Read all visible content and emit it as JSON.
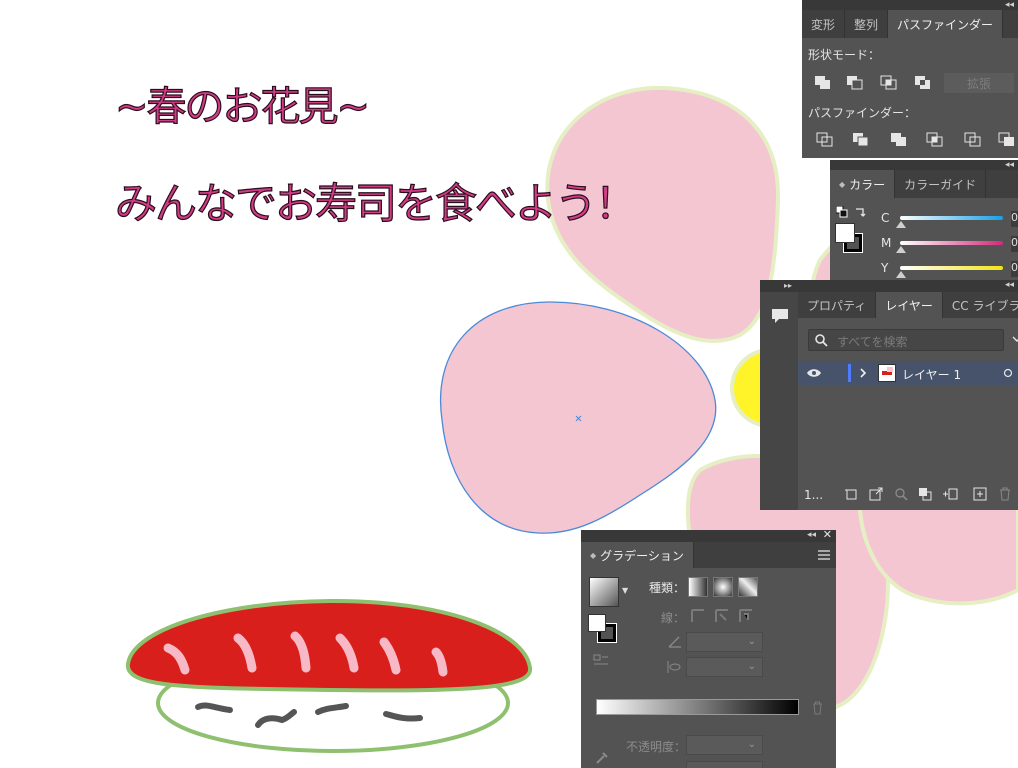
{
  "artwork": {
    "title_line": "~春のお花見~",
    "subtitle_line": "みんなでお寿司を食べよう！",
    "colors": {
      "title_fill": "#d03c86",
      "title_stroke": "#2a0d1c",
      "petal": "#f4c6d2",
      "petal_outline": "#e6efc4",
      "flower_center": "#fff42a",
      "sushi_tuna": "#d91f1c",
      "sushi_outline": "#8ec070",
      "selection": "#4a8ad8"
    }
  },
  "pathfinder_panel": {
    "tabs": [
      "変形",
      "整列",
      "パスファインダー"
    ],
    "active_tab": "パスファインダー",
    "shape_modes_label": "形状モード：",
    "expand_button": "拡張",
    "pathfinders_label": "パスファインダー："
  },
  "color_panel": {
    "tabs": [
      "カラー",
      "カラーガイド"
    ],
    "active_tab": "カラー",
    "channels": [
      {
        "label": "C",
        "value": "0",
        "color": "#16a0e6"
      },
      {
        "label": "M",
        "value": "0",
        "color": "#d4287a"
      },
      {
        "label": "Y",
        "value": "0",
        "color": "#f2e414"
      }
    ]
  },
  "layers_panel": {
    "tabs": [
      "プロパティ",
      "レイヤー",
      "CC ライブラリ"
    ],
    "active_tab": "レイヤー",
    "search_placeholder": "すべてを検索",
    "layers": [
      {
        "name": "レイヤー 1",
        "visible": true,
        "expanded": false
      }
    ],
    "layer_count": "1..."
  },
  "gradient_panel": {
    "tab": "グラデーション",
    "type_label": "種類：",
    "stroke_label": "線：",
    "opacity_label": "不透明度："
  }
}
